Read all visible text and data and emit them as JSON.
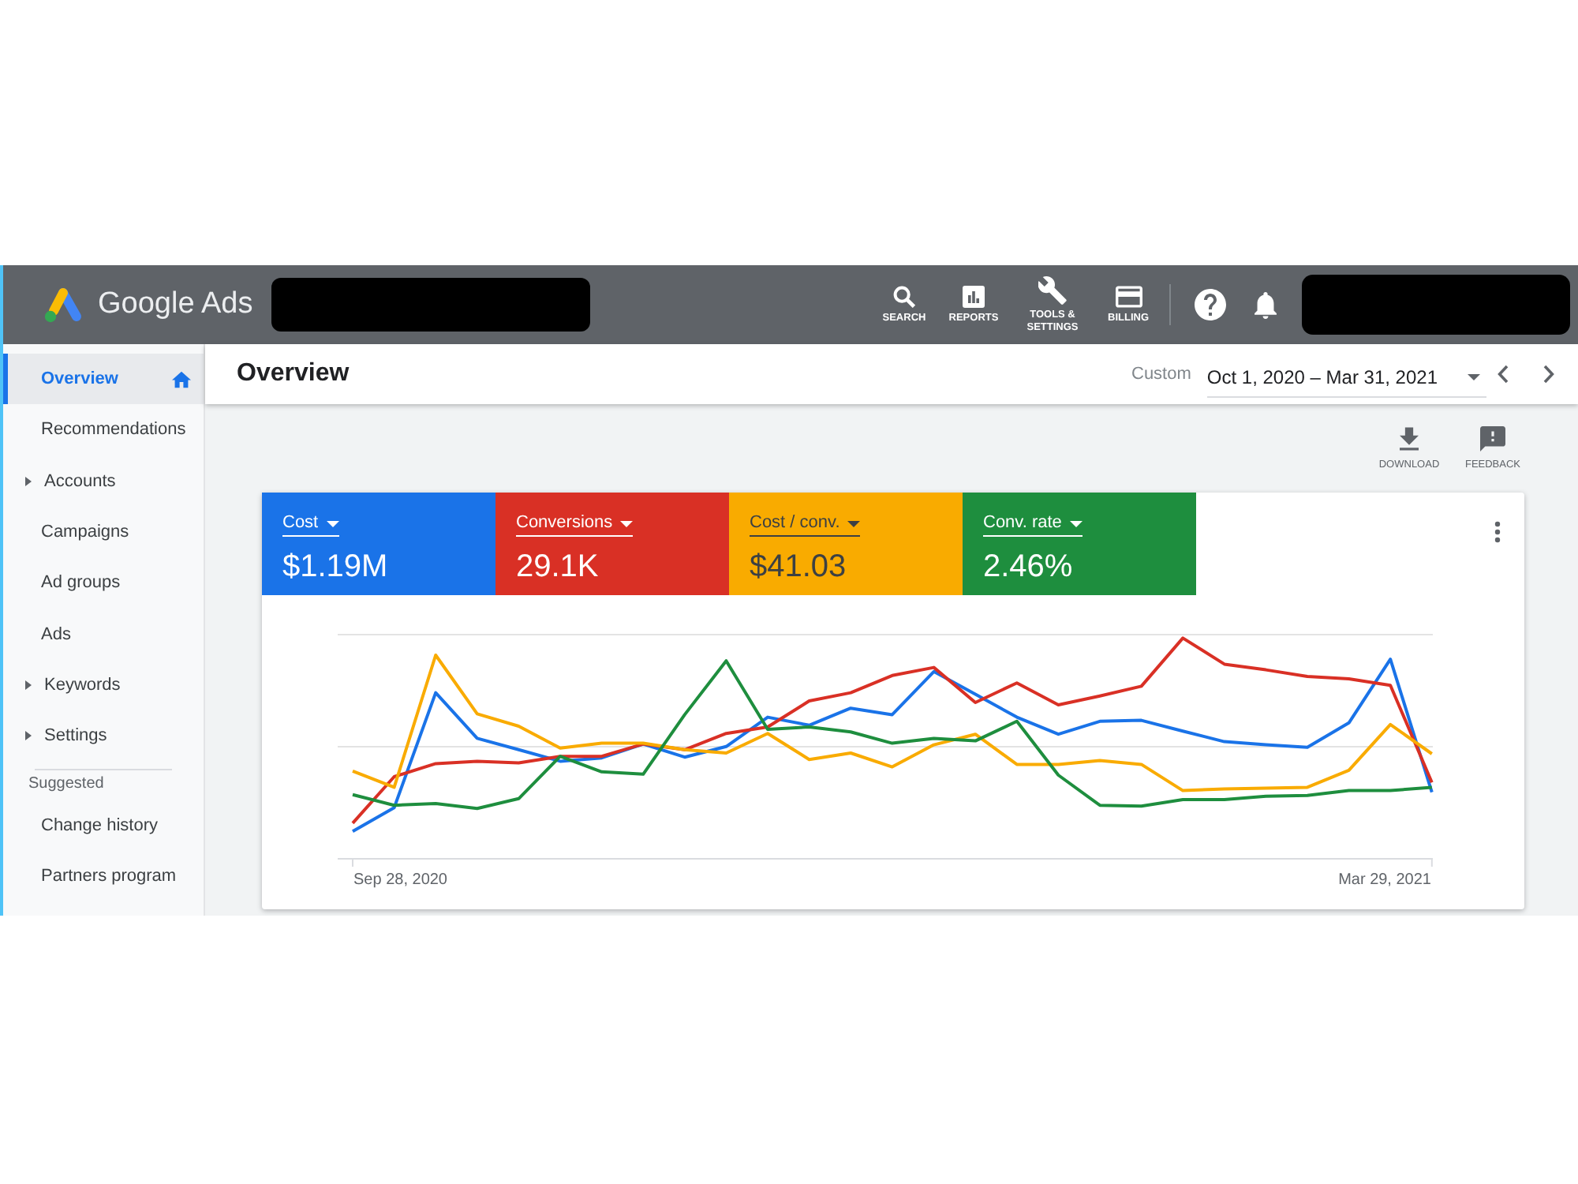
{
  "header": {
    "product_name": "Google Ads",
    "tools": [
      {
        "kind": "search",
        "label": "SEARCH"
      },
      {
        "kind": "reports",
        "label": "REPORTS"
      },
      {
        "kind": "tools",
        "label": "TOOLS & SETTINGS"
      },
      {
        "kind": "billing",
        "label": "BILLING"
      }
    ]
  },
  "sidebar": {
    "items": [
      {
        "label": "Overview",
        "selected": true,
        "expandable": false
      },
      {
        "label": "Recommendations",
        "selected": false,
        "expandable": false
      },
      {
        "label": "Accounts",
        "selected": false,
        "expandable": true
      },
      {
        "label": "Campaigns",
        "selected": false,
        "expandable": false
      },
      {
        "label": "Ad groups",
        "selected": false,
        "expandable": false
      },
      {
        "label": "Ads",
        "selected": false,
        "expandable": false
      },
      {
        "label": "Keywords",
        "selected": false,
        "expandable": true
      },
      {
        "label": "Settings",
        "selected": false,
        "expandable": true
      }
    ],
    "section_label": "Suggested",
    "suggested_items": [
      {
        "label": "Change history",
        "selected": false
      },
      {
        "label": "Partners program",
        "selected": false
      }
    ]
  },
  "page": {
    "title": "Overview",
    "date_preset": "Custom",
    "date_range": "Oct 1, 2020 – Mar 31, 2021",
    "actions": [
      {
        "kind": "download",
        "label": "DOWNLOAD"
      },
      {
        "kind": "feedback",
        "label": "FEEDBACK"
      }
    ]
  },
  "metrics": [
    {
      "label": "Cost",
      "value": "$1.19M",
      "color": "#1a73e8"
    },
    {
      "label": "Conversions",
      "value": "29.1K",
      "color": "#d93025"
    },
    {
      "label": "Cost / conv.",
      "value": "$41.03",
      "color": "#f9ab00"
    },
    {
      "label": "Conv. rate",
      "value": "2.46%",
      "color": "#1e8e3e"
    }
  ],
  "chart": {
    "start_label": "Sep 28, 2020",
    "end_label": "Mar 29, 2021"
  }
}
